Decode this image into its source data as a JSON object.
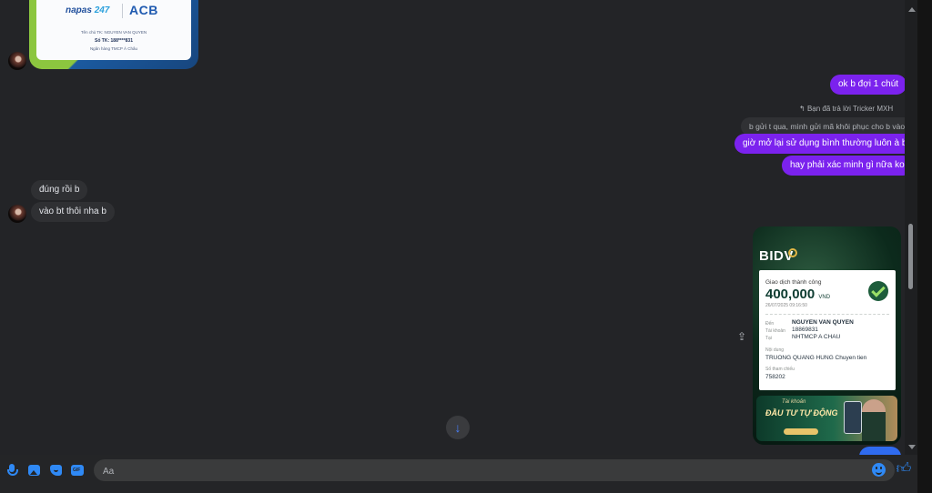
{
  "ticket": {
    "brand_napas": "napas",
    "brand_napas_num": "247",
    "brand_acb": "ACB",
    "holder": "Tên chủ TK: NGUYEN VAN QUYEN",
    "account": "Số TK: 188****831",
    "bank": "Ngân hàng TMCP Á Châu"
  },
  "messages": {
    "out_1": "ok b đợi 1 chút",
    "reply_header": "Bạn đã trả lời Tricker MXH",
    "quoted": "b gửi t qua, mình gửi mã khôi phục cho b vào",
    "out_2": "giờ mở lại sử dụng bình thường luôn à b",
    "out_3": "hay phải xác minh gì nữa ko",
    "in_1": "đúng rồi b",
    "in_2": "vào bt thôi nha b"
  },
  "receipt": {
    "bank": "BIDV",
    "status": "Giao dịch thành công",
    "amount": "400,000",
    "currency": "VND",
    "datetime": "26/07/2025 09:16:50",
    "to_label": "Đến",
    "to_name": "NGUYEN VAN QUYEN",
    "acct_label": "Tài khoản",
    "acct_no": "18869831",
    "at_label": "Tại",
    "at_bank": "NHTMCP A CHAU",
    "content_label": "Nội dung",
    "content": "TRUONG QUANG HUNG Chuyen tien",
    "ref_label": "Số tham chiếu",
    "ref": "758202",
    "banner_small": "Tài khoản",
    "banner_big": "ĐẦU TƯ TỰ ĐỘNG"
  },
  "composer": {
    "placeholder": "Aa"
  },
  "icons": {
    "mic": "microphone-icon",
    "image": "image-icon",
    "sticker": "sticker-icon",
    "gif": "gif-icon",
    "emoji": "emoji-icon",
    "like": "thumbs-up-icon",
    "scroll_down": "arrow-down-icon",
    "share": "share-icon",
    "reply": "reply-icon"
  },
  "colors": {
    "outgoing_bubble": "#7b22ee",
    "incoming_bubble": "#2f3033",
    "accent": "#2f89f5",
    "background": "#232427"
  }
}
